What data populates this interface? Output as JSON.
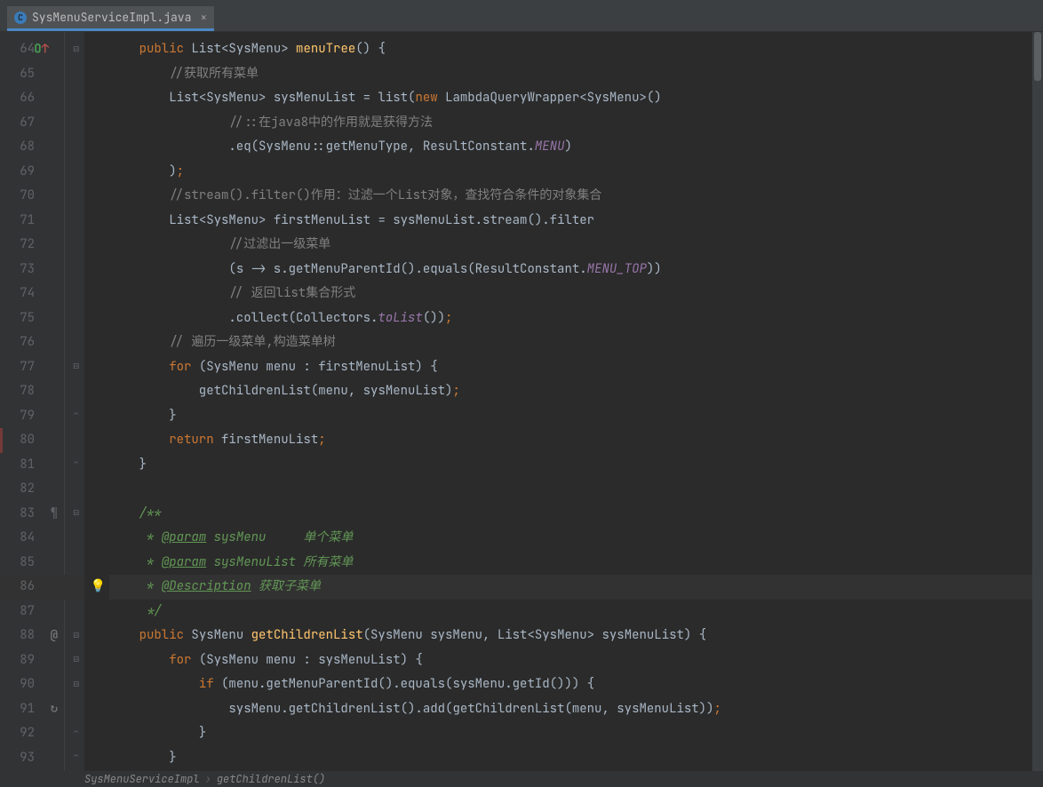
{
  "tab": {
    "icon_letter": "C",
    "title": "SysMenuServiceImpl.java"
  },
  "gutter": {
    "start": 64,
    "end": 93,
    "current": 86,
    "override_marker_line": 64,
    "at_symbol_line": 88,
    "recursive_line": 91,
    "bulb_line": 86,
    "indent_line": 83,
    "error_lines": [
      80
    ]
  },
  "fold_markers": {
    "64": "–",
    "77": "–",
    "79": "⌃",
    "81": "⌃",
    "83": "–",
    "88": "–",
    "89": "–",
    "90": "–",
    "92": "⌃",
    "93": "⌃"
  },
  "code": {
    "64": [
      [
        "kw",
        "    public "
      ],
      [
        "type",
        "List"
      ],
      [
        "paren",
        "<"
      ],
      [
        "type",
        "SysMenu"
      ],
      [
        "paren",
        "> "
      ],
      [
        "method",
        "menuTree"
      ],
      [
        "paren",
        "() "
      ],
      [
        "paren",
        "{"
      ]
    ],
    "65": [
      [
        "plain",
        "        "
      ],
      [
        "com",
        "//获取所有菜单"
      ]
    ],
    "66": [
      [
        "plain",
        "        "
      ],
      [
        "type",
        "List"
      ],
      [
        "paren",
        "<"
      ],
      [
        "type",
        "SysMenu"
      ],
      [
        "paren",
        "> "
      ],
      [
        "plain",
        "sysMenuList = list"
      ],
      [
        "paren",
        "("
      ],
      [
        "kw",
        "new "
      ],
      [
        "type",
        "LambdaQueryWrapper"
      ],
      [
        "paren",
        "<"
      ],
      [
        "type",
        "SysMenu"
      ],
      [
        "paren",
        ">()"
      ]
    ],
    "67": [
      [
        "plain",
        "                "
      ],
      [
        "com",
        "//::在java8中的作用就是获得方法"
      ]
    ],
    "68": [
      [
        "plain",
        "                .eq"
      ],
      [
        "paren",
        "("
      ],
      [
        "type",
        "SysMenu"
      ],
      [
        "plain",
        "::"
      ],
      [
        "plain",
        "getMenuType"
      ],
      [
        "paren",
        ", "
      ],
      [
        "type",
        "ResultConstant"
      ],
      [
        "plain",
        "."
      ],
      [
        "static",
        "MENU"
      ],
      [
        "paren",
        ")"
      ]
    ],
    "69": [
      [
        "plain",
        "        "
      ],
      [
        "paren",
        ")"
      ],
      [
        "semi",
        ";"
      ]
    ],
    "70": [
      [
        "plain",
        "        "
      ],
      [
        "com",
        "//stream().filter()作用：过滤一个List对象，查找符合条件的对象集合"
      ]
    ],
    "71": [
      [
        "plain",
        "        "
      ],
      [
        "type",
        "List"
      ],
      [
        "paren",
        "<"
      ],
      [
        "type",
        "SysMenu"
      ],
      [
        "paren",
        "> "
      ],
      [
        "plain",
        "firstMenuList = sysMenuList.stream"
      ],
      [
        "paren",
        "()"
      ],
      [
        "plain",
        ".filter"
      ]
    ],
    "72": [
      [
        "plain",
        "                "
      ],
      [
        "com",
        "//过滤出一级菜单"
      ]
    ],
    "73": [
      [
        "plain",
        "                "
      ],
      [
        "paren",
        "("
      ],
      [
        "plain",
        "s -> s.getMenuParentId"
      ],
      [
        "paren",
        "()"
      ],
      [
        "plain",
        ".equals"
      ],
      [
        "paren",
        "("
      ],
      [
        "type",
        "ResultConstant"
      ],
      [
        "plain",
        "."
      ],
      [
        "static",
        "MENU_TOP"
      ],
      [
        "paren",
        "))"
      ]
    ],
    "74": [
      [
        "plain",
        "                "
      ],
      [
        "com",
        "// 返回list集合形式"
      ]
    ],
    "75": [
      [
        "plain",
        "                .collect"
      ],
      [
        "paren",
        "("
      ],
      [
        "type",
        "Collectors"
      ],
      [
        "plain",
        "."
      ],
      [
        "static",
        "toList"
      ],
      [
        "paren",
        "())"
      ],
      [
        "semi",
        ";"
      ]
    ],
    "76": [
      [
        "plain",
        "        "
      ],
      [
        "com",
        "// 遍历一级菜单,构造菜单树"
      ]
    ],
    "77": [
      [
        "plain",
        "        "
      ],
      [
        "kw",
        "for "
      ],
      [
        "paren",
        "("
      ],
      [
        "type",
        "SysMenu "
      ],
      [
        "plain",
        "menu : firstMenuList"
      ],
      [
        "paren",
        ") {"
      ]
    ],
    "78": [
      [
        "plain",
        "            getChildrenList"
      ],
      [
        "paren",
        "("
      ],
      [
        "plain",
        "menu"
      ],
      [
        "paren",
        ", "
      ],
      [
        "plain",
        "sysMenuList"
      ],
      [
        "paren",
        ")"
      ],
      [
        "semi",
        ";"
      ]
    ],
    "79": [
      [
        "plain",
        "        "
      ],
      [
        "paren",
        "}"
      ]
    ],
    "80": [
      [
        "plain",
        "        "
      ],
      [
        "kw",
        "return "
      ],
      [
        "plain",
        "firstMenuList"
      ],
      [
        "semi",
        ";"
      ]
    ],
    "81": [
      [
        "plain",
        "    "
      ],
      [
        "paren",
        "}"
      ]
    ],
    "82": [
      [
        "plain",
        ""
      ]
    ],
    "83": [
      [
        "plain",
        "    "
      ],
      [
        "comdoc",
        "/**"
      ]
    ],
    "84": [
      [
        "plain",
        "    "
      ],
      [
        "comdoc",
        " * "
      ],
      [
        "tag",
        "@param"
      ],
      [
        "comdoc",
        " sysMenu     单个菜单"
      ]
    ],
    "85": [
      [
        "plain",
        "    "
      ],
      [
        "comdoc",
        " * "
      ],
      [
        "tag",
        "@param"
      ],
      [
        "comdoc",
        " sysMenuList 所有菜单"
      ]
    ],
    "86": [
      [
        "plain",
        "    "
      ],
      [
        "comdoc",
        " * "
      ],
      [
        "tag",
        "@Description"
      ],
      [
        "comdoc",
        " 获取子菜单"
      ]
    ],
    "87": [
      [
        "plain",
        "    "
      ],
      [
        "comdoc",
        " */"
      ]
    ],
    "88": [
      [
        "plain",
        "    "
      ],
      [
        "kw",
        "public "
      ],
      [
        "type",
        "SysMenu "
      ],
      [
        "method",
        "getChildrenList"
      ],
      [
        "paren",
        "("
      ],
      [
        "type",
        "SysMenu "
      ],
      [
        "plain",
        "sysMenu"
      ],
      [
        "paren",
        ", "
      ],
      [
        "type",
        "List"
      ],
      [
        "paren",
        "<"
      ],
      [
        "type",
        "SysMenu"
      ],
      [
        "paren",
        "> "
      ],
      [
        "plain",
        "sysMenuList"
      ],
      [
        "paren",
        ") {"
      ]
    ],
    "89": [
      [
        "plain",
        "        "
      ],
      [
        "kw",
        "for "
      ],
      [
        "paren",
        "("
      ],
      [
        "type",
        "SysMenu "
      ],
      [
        "plain",
        "menu : sysMenuList"
      ],
      [
        "paren",
        ") {"
      ]
    ],
    "90": [
      [
        "plain",
        "            "
      ],
      [
        "kw",
        "if "
      ],
      [
        "paren",
        "("
      ],
      [
        "plain",
        "menu.getMenuParentId"
      ],
      [
        "paren",
        "()"
      ],
      [
        "plain",
        ".equals"
      ],
      [
        "paren",
        "("
      ],
      [
        "plain",
        "sysMenu.getId"
      ],
      [
        "paren",
        "())) {"
      ]
    ],
    "91": [
      [
        "plain",
        "                sysMenu.getChildrenList"
      ],
      [
        "paren",
        "()"
      ],
      [
        "plain",
        ".add"
      ],
      [
        "paren",
        "("
      ],
      [
        "plain",
        "getChildrenList"
      ],
      [
        "paren",
        "("
      ],
      [
        "plain",
        "menu"
      ],
      [
        "paren",
        ", "
      ],
      [
        "plain",
        "sysMenuList"
      ],
      [
        "paren",
        "))"
      ],
      [
        "semi",
        ";"
      ]
    ],
    "92": [
      [
        "plain",
        "            "
      ],
      [
        "paren",
        "}"
      ]
    ],
    "93": [
      [
        "plain",
        "        "
      ],
      [
        "paren",
        "}"
      ]
    ]
  },
  "breadcrumb": [
    "SysMenuServiceImpl",
    "getChildrenList()"
  ]
}
